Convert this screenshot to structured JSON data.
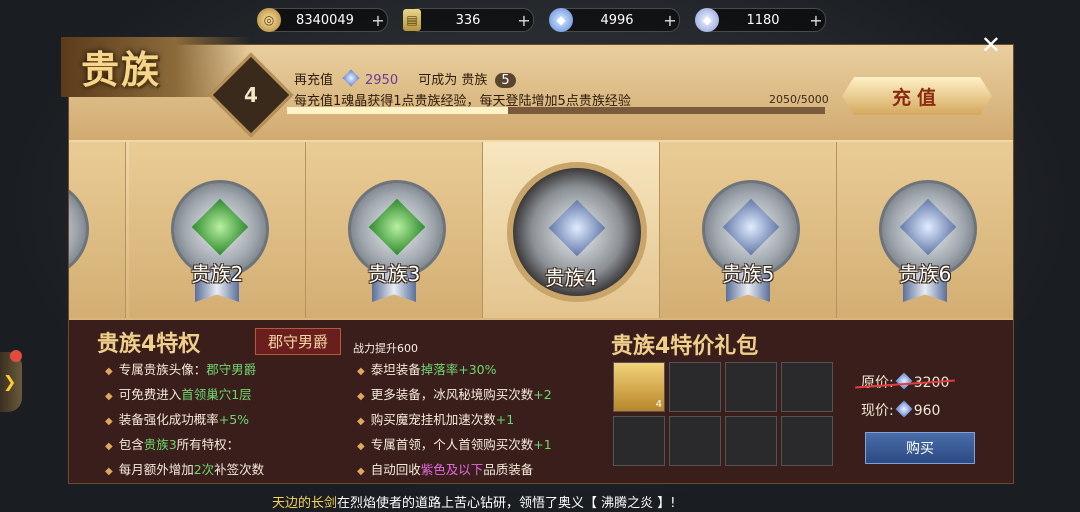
{
  "currencies": [
    {
      "icon": "gold-coin-icon",
      "value": "8340049",
      "plus": "+"
    },
    {
      "icon": "ticket-icon",
      "value": "336",
      "plus": "+"
    },
    {
      "icon": "locked-gem-icon",
      "value": "4996",
      "plus": "+"
    },
    {
      "icon": "soul-crystal-icon",
      "value": "1180",
      "plus": "+"
    }
  ],
  "header": {
    "title": "贵族",
    "close": "✕",
    "vip_level": "4",
    "recharge_prefix": "再充值",
    "recharge_amount": "2950",
    "become": "可成为 贵族",
    "next_level": "5",
    "desc": "每充值1魂晶获得1点贵族经验，每天登陆增加5点贵族经验",
    "progress_text": "2050/5000",
    "progress": 0.41,
    "charge_button": "充值"
  },
  "levels": [
    {
      "label": "贵族2",
      "gem": "green"
    },
    {
      "label": "贵族3",
      "gem": "green"
    },
    {
      "label": "贵族4",
      "gem": "blue",
      "active": true
    },
    {
      "label": "贵族5",
      "gem": "blue"
    },
    {
      "label": "贵族6",
      "gem": "blue"
    }
  ],
  "privileges": {
    "title": "贵族4特权",
    "tag": "郡守男爵",
    "power": "战力提升600",
    "left": [
      {
        "a": "专属贵族头像：",
        "b": "郡守男爵",
        "c": ""
      },
      {
        "a": "可免费进入",
        "b": "首领巢穴1层",
        "c": ""
      },
      {
        "a": "装备强化成功概率",
        "b": "+5%",
        "c": ""
      },
      {
        "a": "包含",
        "b": "贵族3",
        "c": "所有特权："
      },
      {
        "a": "每月额外增加",
        "b": "2次",
        "c": "补签次数"
      }
    ],
    "right": [
      {
        "a": "泰坦装备",
        "b": "掉落率+30%",
        "c": ""
      },
      {
        "a": "更多装备，冰风秘境购买次数",
        "b": "+2",
        "c": ""
      },
      {
        "a": "购买魔宠挂机加速次数",
        "b": "+1",
        "c": ""
      },
      {
        "a": "专属首领，个人首领购买次数",
        "b": "+1",
        "c": ""
      },
      {
        "a": "自动回收",
        "b": "紫色及以下",
        "c": "品质装备"
      }
    ]
  },
  "gift": {
    "title": "贵族4特价礼包",
    "item_count": "4",
    "original_label": "原价:",
    "original_price": "3200",
    "current_label": "现价:",
    "current_price": "960",
    "buy": "购买"
  },
  "chat": {
    "a": "天边的长剑",
    "b": "在烈焰使者的道路上苦心钻研，领悟了奥义【 沸腾之炎 】!"
  }
}
